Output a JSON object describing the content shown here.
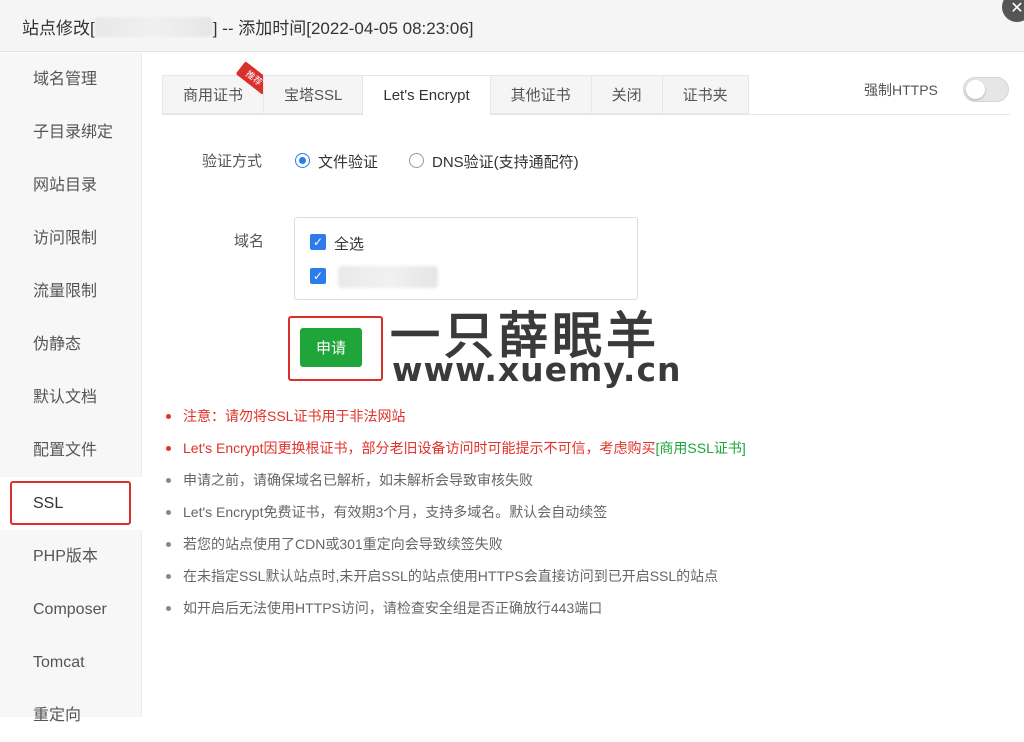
{
  "window": {
    "title_prefix": "站点修改[",
    "title_suffix": "] -- 添加时间[2022-04-05 08:23:06]",
    "close_glyph": "✕"
  },
  "sidebar": {
    "items": [
      {
        "label": "域名管理"
      },
      {
        "label": "子目录绑定"
      },
      {
        "label": "网站目录"
      },
      {
        "label": "访问限制"
      },
      {
        "label": "流量限制"
      },
      {
        "label": "伪静态"
      },
      {
        "label": "默认文档"
      },
      {
        "label": "配置文件"
      },
      {
        "label": "SSL"
      },
      {
        "label": "PHP版本"
      },
      {
        "label": "Composer"
      },
      {
        "label": "Tomcat"
      },
      {
        "label": "重定向"
      }
    ],
    "active": "SSL"
  },
  "tabs": {
    "items": [
      {
        "label": "商用证书",
        "badge": "推荐"
      },
      {
        "label": "宝塔SSL"
      },
      {
        "label": "Let's Encrypt"
      },
      {
        "label": "其他证书"
      },
      {
        "label": "关闭"
      },
      {
        "label": "证书夹"
      }
    ],
    "active": "Let's Encrypt"
  },
  "force_https": {
    "label": "强制HTTPS",
    "enabled": false
  },
  "form": {
    "verify_label": "验证方式",
    "verify_options": [
      {
        "label": "文件验证",
        "checked": true
      },
      {
        "label": "DNS验证(支持通配符)",
        "checked": false
      }
    ],
    "domain_label": "域名",
    "select_all_label": "全选",
    "check_glyph": "✓",
    "apply_label": "申请"
  },
  "watermark": {
    "line1": "一只薛眠羊",
    "line2": "www.xuemy.cn"
  },
  "notes": [
    {
      "text": "注意：请勿将SSL证书用于非法网站",
      "color": "#e0322b"
    },
    {
      "text": "Let's Encrypt因更换根证书，部分老旧设备访问时可能提示不可信，考虑购买",
      "link": "[商用SSL证书]",
      "color": "#e0322b"
    },
    {
      "text": "申请之前，请确保域名已解析，如未解析会导致审核失败"
    },
    {
      "text": "Let's Encrypt免费证书，有效期3个月，支持多域名。默认会自动续签"
    },
    {
      "text": "若您的站点使用了CDN或301重定向会导致续签失败"
    },
    {
      "text": "在未指定SSL默认站点时,未开启SSL的站点使用HTTPS会直接访问到已开启SSL的站点"
    },
    {
      "text": "如开启后无法使用HTTPS访问，请检查安全组是否正确放行443端口"
    }
  ],
  "colors": {
    "accent_green": "#20a53a",
    "highlight_red": "#d9302c",
    "check_blue": "#2b7de9"
  }
}
